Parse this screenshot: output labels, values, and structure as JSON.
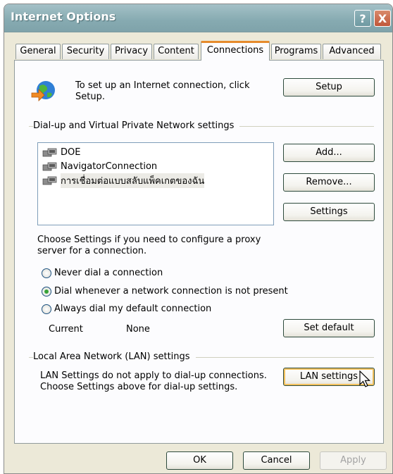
{
  "window": {
    "title": "Internet Options",
    "help_glyph": "?",
    "close_glyph": "X"
  },
  "tabs": [
    {
      "label": "General"
    },
    {
      "label": "Security"
    },
    {
      "label": "Privacy"
    },
    {
      "label": "Content"
    },
    {
      "label": "Connections",
      "active": true
    },
    {
      "label": "Programs"
    },
    {
      "label": "Advanced"
    }
  ],
  "setup": {
    "description": "To set up an Internet connection, click Setup.",
    "button": "Setup"
  },
  "dialup": {
    "section_label": "Dial-up and Virtual Private Network settings",
    "connections": [
      {
        "name": "DOE"
      },
      {
        "name": "NavigatorConnection"
      },
      {
        "name": "การเชื่อมต่อแบบสลับแพ็คเกตของฉัน",
        "selected": true
      }
    ],
    "add_button": "Add...",
    "remove_button": "Remove...",
    "settings_button": "Settings",
    "proxy_hint": "Choose Settings if you need to configure a proxy server for a connection.",
    "options": [
      {
        "label": "Never dial a connection",
        "checked": false
      },
      {
        "label": "Dial whenever a network connection is not present",
        "checked": true
      },
      {
        "label": "Always dial my default connection",
        "checked": false
      }
    ],
    "current_label": "Current",
    "current_value": "None",
    "set_default_button": "Set default"
  },
  "lan": {
    "section_label": "Local Area Network (LAN) settings",
    "note": "LAN Settings do not apply to dial-up connections. Choose Settings above for dial-up settings.",
    "button": "LAN settings"
  },
  "footer": {
    "ok": "OK",
    "cancel": "Cancel",
    "apply": "Apply"
  },
  "colors": {
    "active_tab_accent": "#e68b2c",
    "dialog_background": "#ece9d8",
    "button_hover_glow": "#f4c25f"
  }
}
